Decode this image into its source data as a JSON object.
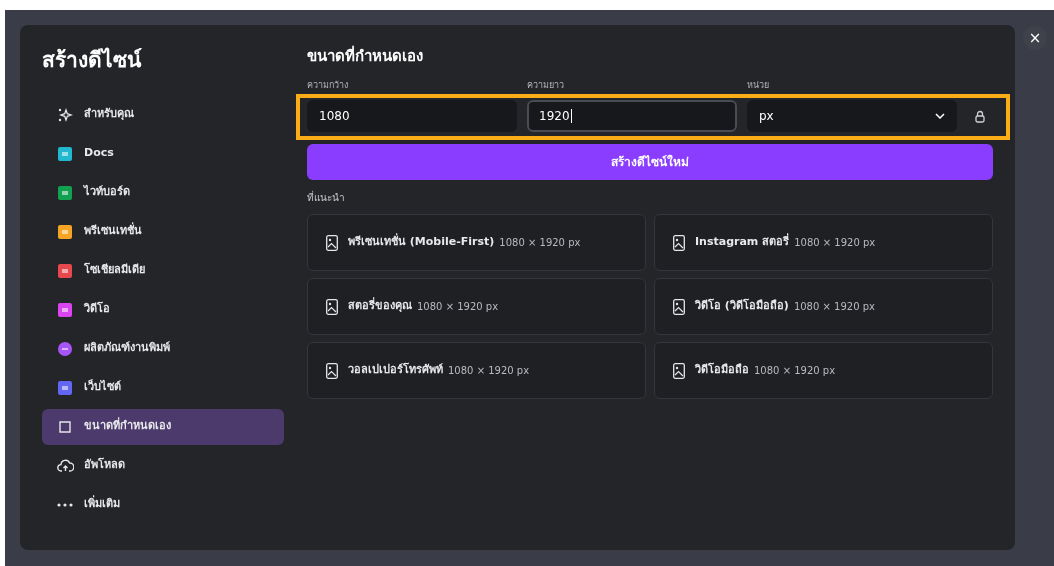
{
  "sidebar": {
    "title": "สร้างดีไซน์",
    "items": [
      {
        "label": "สำหรับคุณ",
        "kind": "sparkle",
        "selected": false
      },
      {
        "label": "Docs",
        "kind": "square",
        "color": "#22b8cf",
        "selected": false
      },
      {
        "label": "ไวท์บอร์ด",
        "kind": "square",
        "color": "#12a150",
        "selected": false
      },
      {
        "label": "พรีเซนเทชั่น",
        "kind": "square",
        "color": "#f5a524",
        "selected": false
      },
      {
        "label": "โซเชียลมีเดีย",
        "kind": "square",
        "color": "#e5484d",
        "selected": false
      },
      {
        "label": "วิดีโอ",
        "kind": "square",
        "color": "#d946ef",
        "selected": false
      },
      {
        "label": "ผลิตภัณฑ์งานพิมพ์",
        "kind": "circle",
        "color": "#a855f7",
        "selected": false
      },
      {
        "label": "เว็บไซต์",
        "kind": "square",
        "color": "#6366f1",
        "selected": false
      },
      {
        "label": "ขนาดที่กำหนดเอง",
        "kind": "resize",
        "selected": true
      },
      {
        "label": "อัพโหลด",
        "kind": "cloud",
        "selected": false
      },
      {
        "label": "เพิ่มเติม",
        "kind": "dots",
        "selected": false
      }
    ]
  },
  "main": {
    "title": "ขนาดที่กำหนดเอง",
    "fields": [
      {
        "label": "ความกว้าง",
        "value": "1080",
        "kind": "input",
        "focused": false
      },
      {
        "label": "ความยาว",
        "value": "1920",
        "kind": "input",
        "focused": true
      },
      {
        "label": "หน่วย",
        "value": "px",
        "kind": "select",
        "focused": false
      }
    ],
    "create_button": "สร้างดีไซน์ใหม่",
    "suggested_heading": "ที่แนะนำ",
    "suggestions": [
      {
        "name": "พรีเซนเทชั่น (Mobile-First)",
        "size": "1080 × 1920 px"
      },
      {
        "name": "Instagram สตอรี่",
        "size": "1080 × 1920 px"
      },
      {
        "name": "สตอรี่ของคุณ",
        "size": "1080 × 1920 px"
      },
      {
        "name": "วิดีโอ (วิดีโอมือถือ)",
        "size": "1080 × 1920 px"
      },
      {
        "name": "วอลเปเปอร์โทรศัพท์",
        "size": "1080 × 1920 px"
      },
      {
        "name": "วิดีโอมือถือ",
        "size": "1080 × 1920 px"
      }
    ]
  },
  "close_button": "×"
}
